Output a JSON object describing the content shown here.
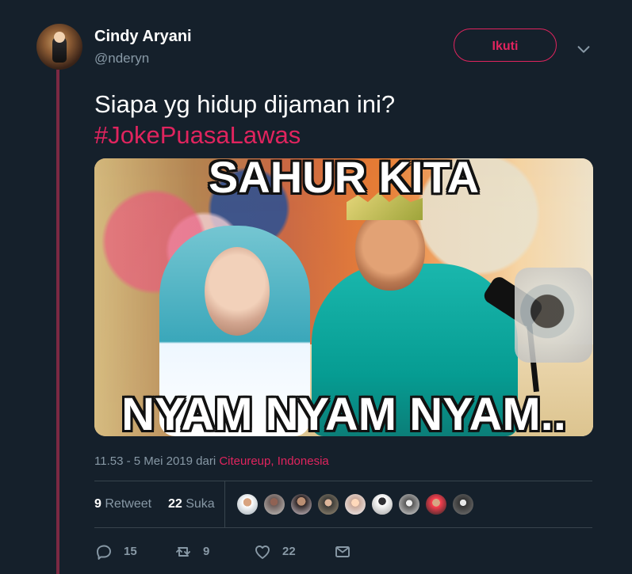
{
  "tweet": {
    "author": {
      "name": "Cindy Aryani",
      "handle": "@nderyn"
    },
    "follow_label": "Ikuti",
    "text_line_1": "Siapa yg hidup dijaman ini?",
    "hashtag": "#JokePuasaLawas",
    "media": {
      "top_text": "SAHUR KITA",
      "bottom_text": "NYAM NYAM NYAM.."
    },
    "timestamp": "11.53 - 5 Mei 2019 dari",
    "location": "Citeureup, Indonesia",
    "stats": {
      "retweets": "9",
      "retweets_label": "Retweet",
      "likes": "22",
      "likes_label": "Suka"
    },
    "actions": {
      "reply_count": "15",
      "retweet_count": "9",
      "like_count": "22"
    }
  },
  "colors": {
    "background": "#15202b",
    "accent": "#e0245e",
    "secondary_text": "#8899a6",
    "border": "#38444d",
    "thread_line": "#7b2943"
  },
  "icons": {
    "menu": "chevron-down-icon",
    "reply": "reply-icon",
    "retweet": "retweet-icon",
    "like": "heart-icon",
    "direct_message": "envelope-icon"
  }
}
